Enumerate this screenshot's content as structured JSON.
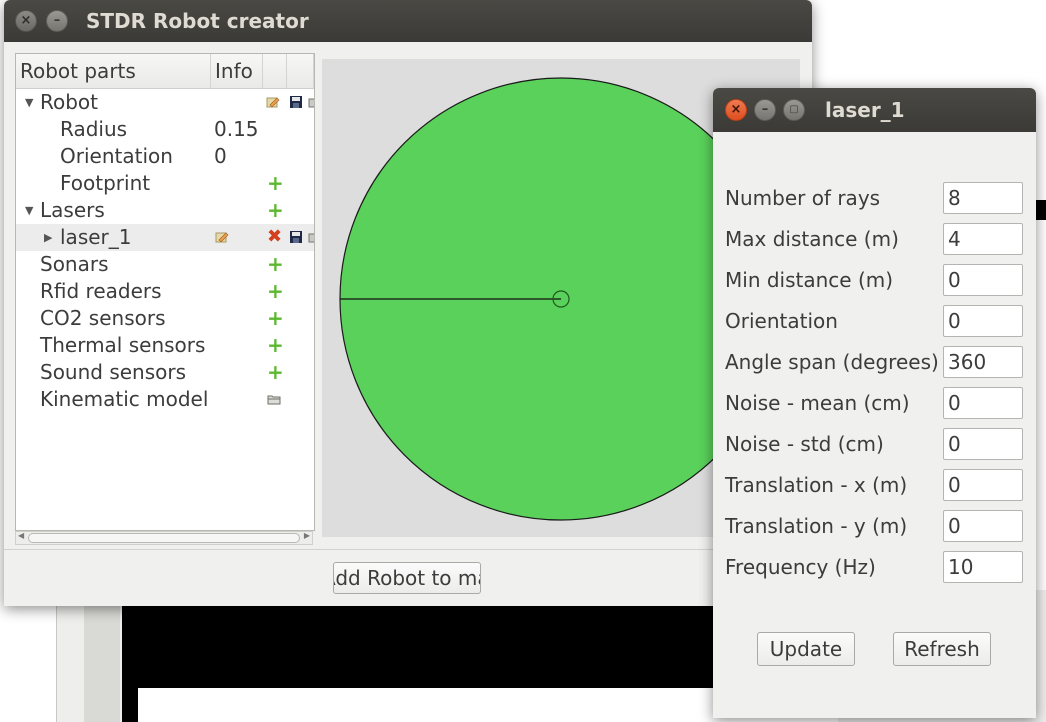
{
  "main_window": {
    "title": "STDR Robot creator",
    "tree": {
      "headers": [
        "Robot parts",
        "Info"
      ],
      "rows": [
        {
          "label": "Robot",
          "info": ""
        },
        {
          "label": "Radius",
          "info": "0.15"
        },
        {
          "label": "Orientation",
          "info": "0"
        },
        {
          "label": "Footprint",
          "info": ""
        },
        {
          "label": "Lasers",
          "info": ""
        },
        {
          "label": "laser_1",
          "info": ""
        },
        {
          "label": "Sonars",
          "info": ""
        },
        {
          "label": "Rfid readers",
          "info": ""
        },
        {
          "label": "CO2 sensors",
          "info": ""
        },
        {
          "label": "Thermal sensors",
          "info": ""
        },
        {
          "label": "Sound sensors",
          "info": ""
        },
        {
          "label": "Kinematic model",
          "info": ""
        }
      ]
    },
    "add_robot_label": "Add Robot to map",
    "colors": {
      "robot_fill": "#5ad15a",
      "canvas_bg": "#dddddd"
    }
  },
  "laser_dialog": {
    "title": "laser_1",
    "fields": [
      {
        "label": "Number of rays",
        "value": "8"
      },
      {
        "label": "Max distance (m)",
        "value": "4"
      },
      {
        "label": "Min distance (m)",
        "value": "0"
      },
      {
        "label": "Orientation",
        "value": "0"
      },
      {
        "label": "Angle span (degrees)",
        "value": "360"
      },
      {
        "label": "Noise - mean (cm)",
        "value": "0"
      },
      {
        "label": "Noise - std (cm)",
        "value": "0"
      },
      {
        "label": "Translation - x (m)",
        "value": "0"
      },
      {
        "label": "Translation - y (m)",
        "value": "0"
      },
      {
        "label": "Frequency (Hz)",
        "value": "10"
      }
    ],
    "update_label": "Update",
    "refresh_label": "Refresh"
  }
}
